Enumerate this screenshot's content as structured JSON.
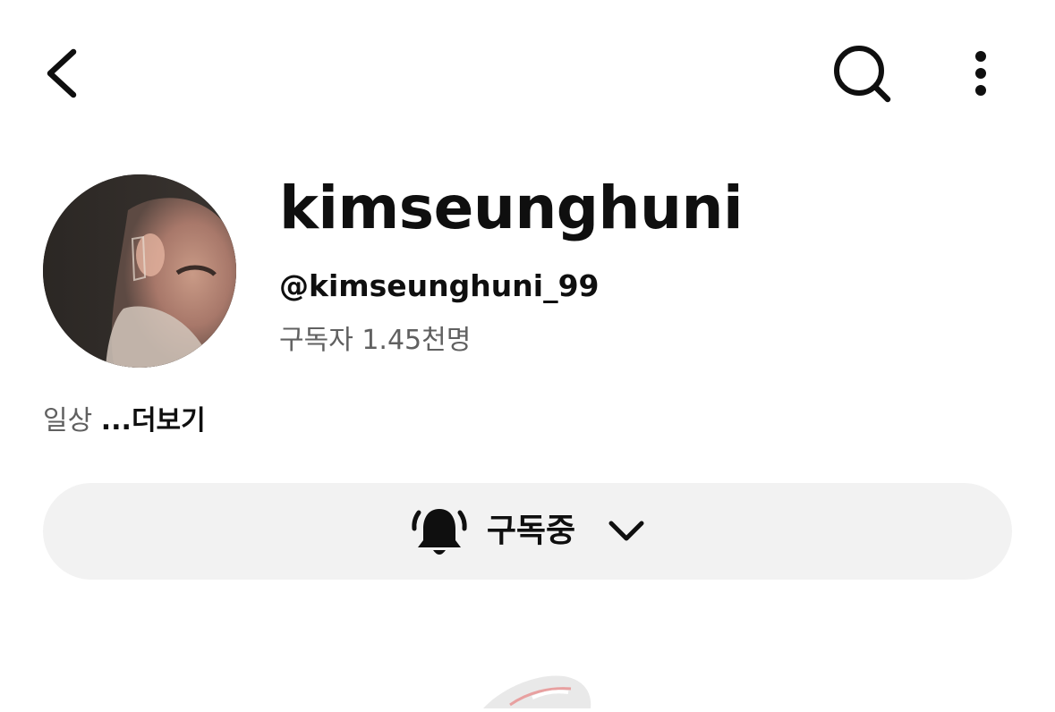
{
  "header": {
    "back_icon": "back-arrow-icon",
    "search_icon": "search-icon",
    "more_icon": "more-vertical-icon"
  },
  "channel": {
    "name": "kimseunghuni",
    "handle": "@kimseunghuni_99",
    "subscribers": "구독자 1.45천명",
    "description": "일상",
    "more_label": "...더보기"
  },
  "subscribe": {
    "label": "구독중",
    "bell_icon": "bell-all-notifications-icon",
    "chevron_icon": "chevron-down-icon",
    "button_color": "#f2f2f2"
  }
}
